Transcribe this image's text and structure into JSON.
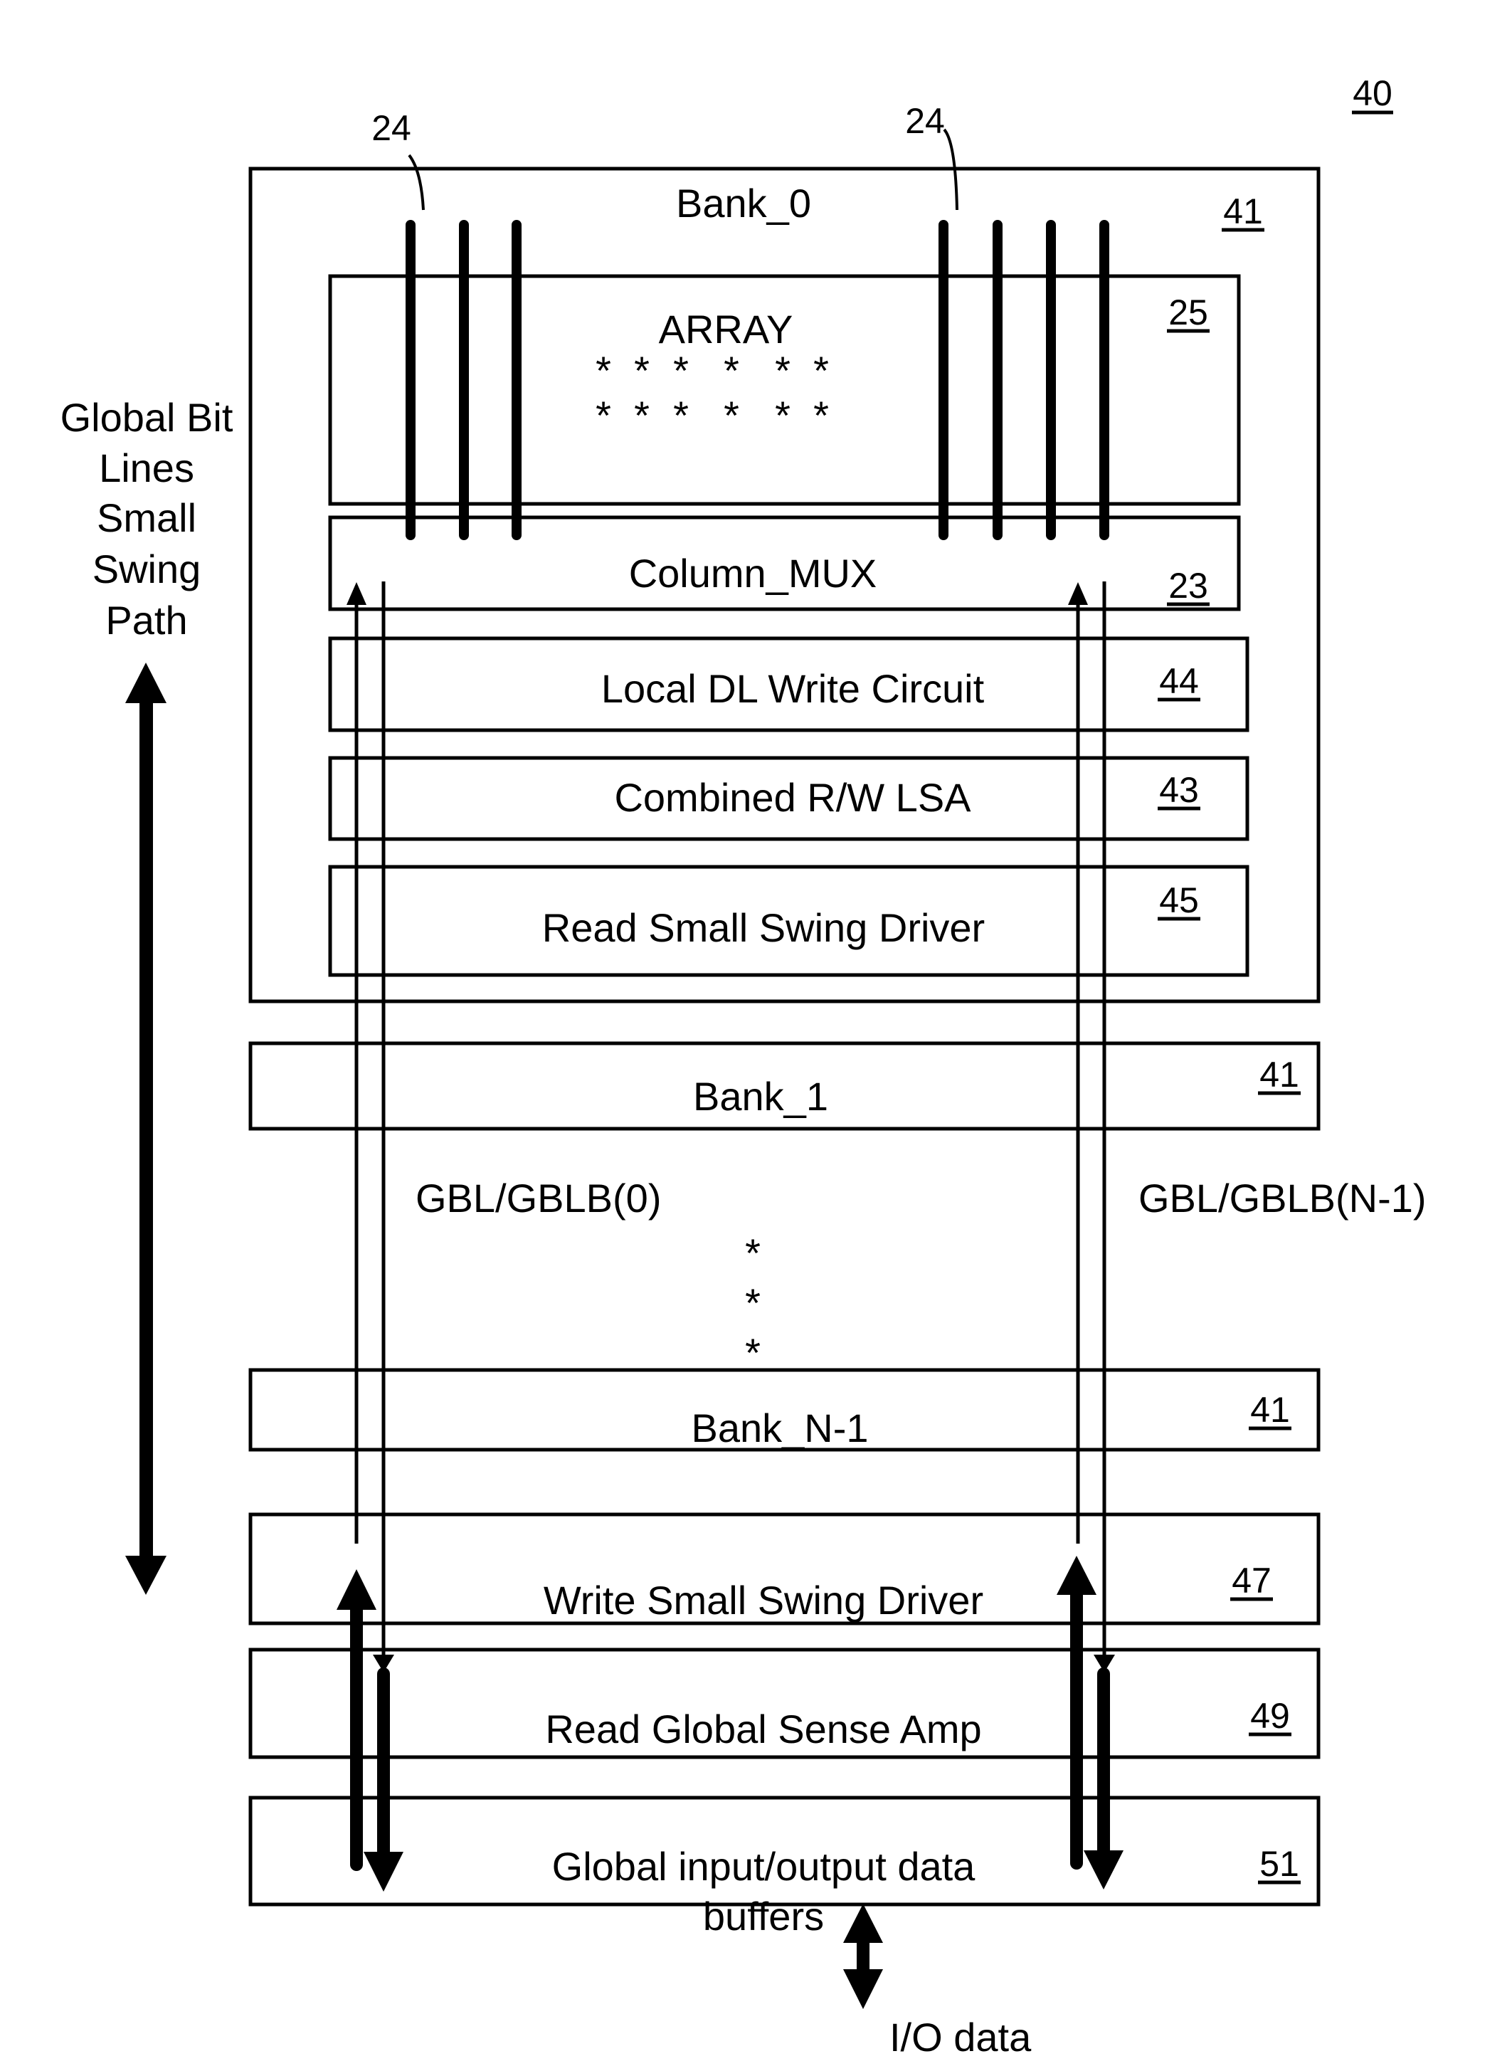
{
  "figure": {
    "ref_number": "40"
  },
  "side_label": {
    "lines": [
      "Global Bit",
      "Lines",
      "Small",
      "Swing",
      "Path"
    ]
  },
  "bit_line_ref": "24",
  "bank0": {
    "title": "Bank_0",
    "ref": "41",
    "array": {
      "label": "ARRAY",
      "ref": "25",
      "dots_rows": [
        [
          "*",
          "*",
          "*",
          "*",
          "*",
          "*"
        ],
        [
          "*",
          "*",
          "*",
          "*",
          "*",
          "*"
        ]
      ]
    },
    "column_mux": {
      "label": "Column_MUX",
      "ref": "23"
    },
    "local_dl_write": {
      "label": "Local DL Write Circuit",
      "ref": "44"
    },
    "combined_lsa": {
      "label": "Combined R/W LSA",
      "ref": "43"
    },
    "read_ssd": {
      "label": "Read Small Swing Driver",
      "ref": "45"
    }
  },
  "bank1": {
    "title": "Bank_1",
    "ref": "41"
  },
  "gbl_labels": {
    "left": "GBL/GBLB(0)",
    "right": "GBL/GBLB(N-1)"
  },
  "ellipsis": [
    "*",
    "*",
    "*"
  ],
  "bankN1": {
    "title": "Bank_N-1",
    "ref": "41"
  },
  "write_ssd": {
    "label": "Write Small Swing Driver",
    "ref": "47"
  },
  "read_gsa": {
    "label": "Read Global Sense Amp",
    "ref": "49"
  },
  "global_io": {
    "line1": "Global input/output data",
    "line2": "buffers",
    "ref": "51"
  },
  "io_data": {
    "label": "I/O data"
  }
}
